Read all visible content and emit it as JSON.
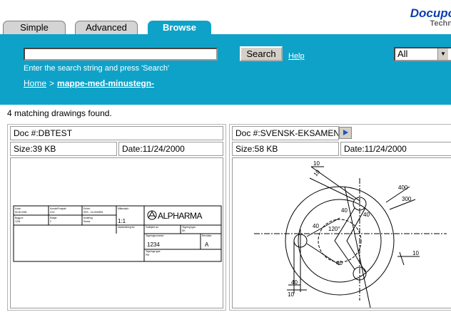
{
  "tabs": [
    {
      "label": "Simple",
      "active": false
    },
    {
      "label": "Advanced",
      "active": false
    },
    {
      "label": "Browse",
      "active": true
    }
  ],
  "brand": {
    "name": "Docupo",
    "sub": "Techn"
  },
  "search": {
    "value": "",
    "hint": "Enter the search string and press 'Search'",
    "button_label": "Search",
    "help_label": "Help",
    "scope_value": "All"
  },
  "breadcrumb": {
    "home": "Home",
    "separator": ">",
    "current": "mappe-med-minustegn-"
  },
  "results": {
    "count_text": "4 matching drawings found."
  },
  "cards": [
    {
      "doc": "Doc #:DBTEST",
      "size": "Size:39 KB",
      "date": "Date:11/24/2000",
      "title_block": {
        "logo": "ALPHARMA",
        "scale": "1:1",
        "drawing_no": "1234",
        "revision": "A",
        "labels": {
          "kode": "Kode:",
          "kunde": "Kunde/Prosjekt:",
          "enhet": "Enhet:",
          "malestokk": "Målestokk:",
          "kode_val": "50.00.0050",
          "kunde_val": "XXX",
          "enhet_val": "SRX - CILONSRM",
          "bygg": "Bygg nr:",
          "etasje": "Etasje:",
          "avdeling": "Avdeling:",
          "bygg_val": "1234",
          "etasje_val": "2",
          "avdeling_val": "Sector",
          "tegnet": "Tegning type:",
          "tegnet_val": "DK",
          "utarbeidet": "Utarbeidning for:",
          "godkjent": "Godkjent av:",
          "tegningsnr": "Tegningsnummer:",
          "rev": "Rev/dato:",
          "tegn_type": "Tegnings type:",
          "tegn_type_val": "PM"
        }
      }
    },
    {
      "doc": "Doc #:SVENSK-EKSAMEN",
      "size": "Size:58 KB",
      "date": "Date:11/24/2000",
      "dimensions": [
        "10",
        "10",
        "400",
        "300",
        "40",
        "40",
        "40",
        "40",
        "120°",
        "40",
        "10",
        "10"
      ]
    }
  ]
}
